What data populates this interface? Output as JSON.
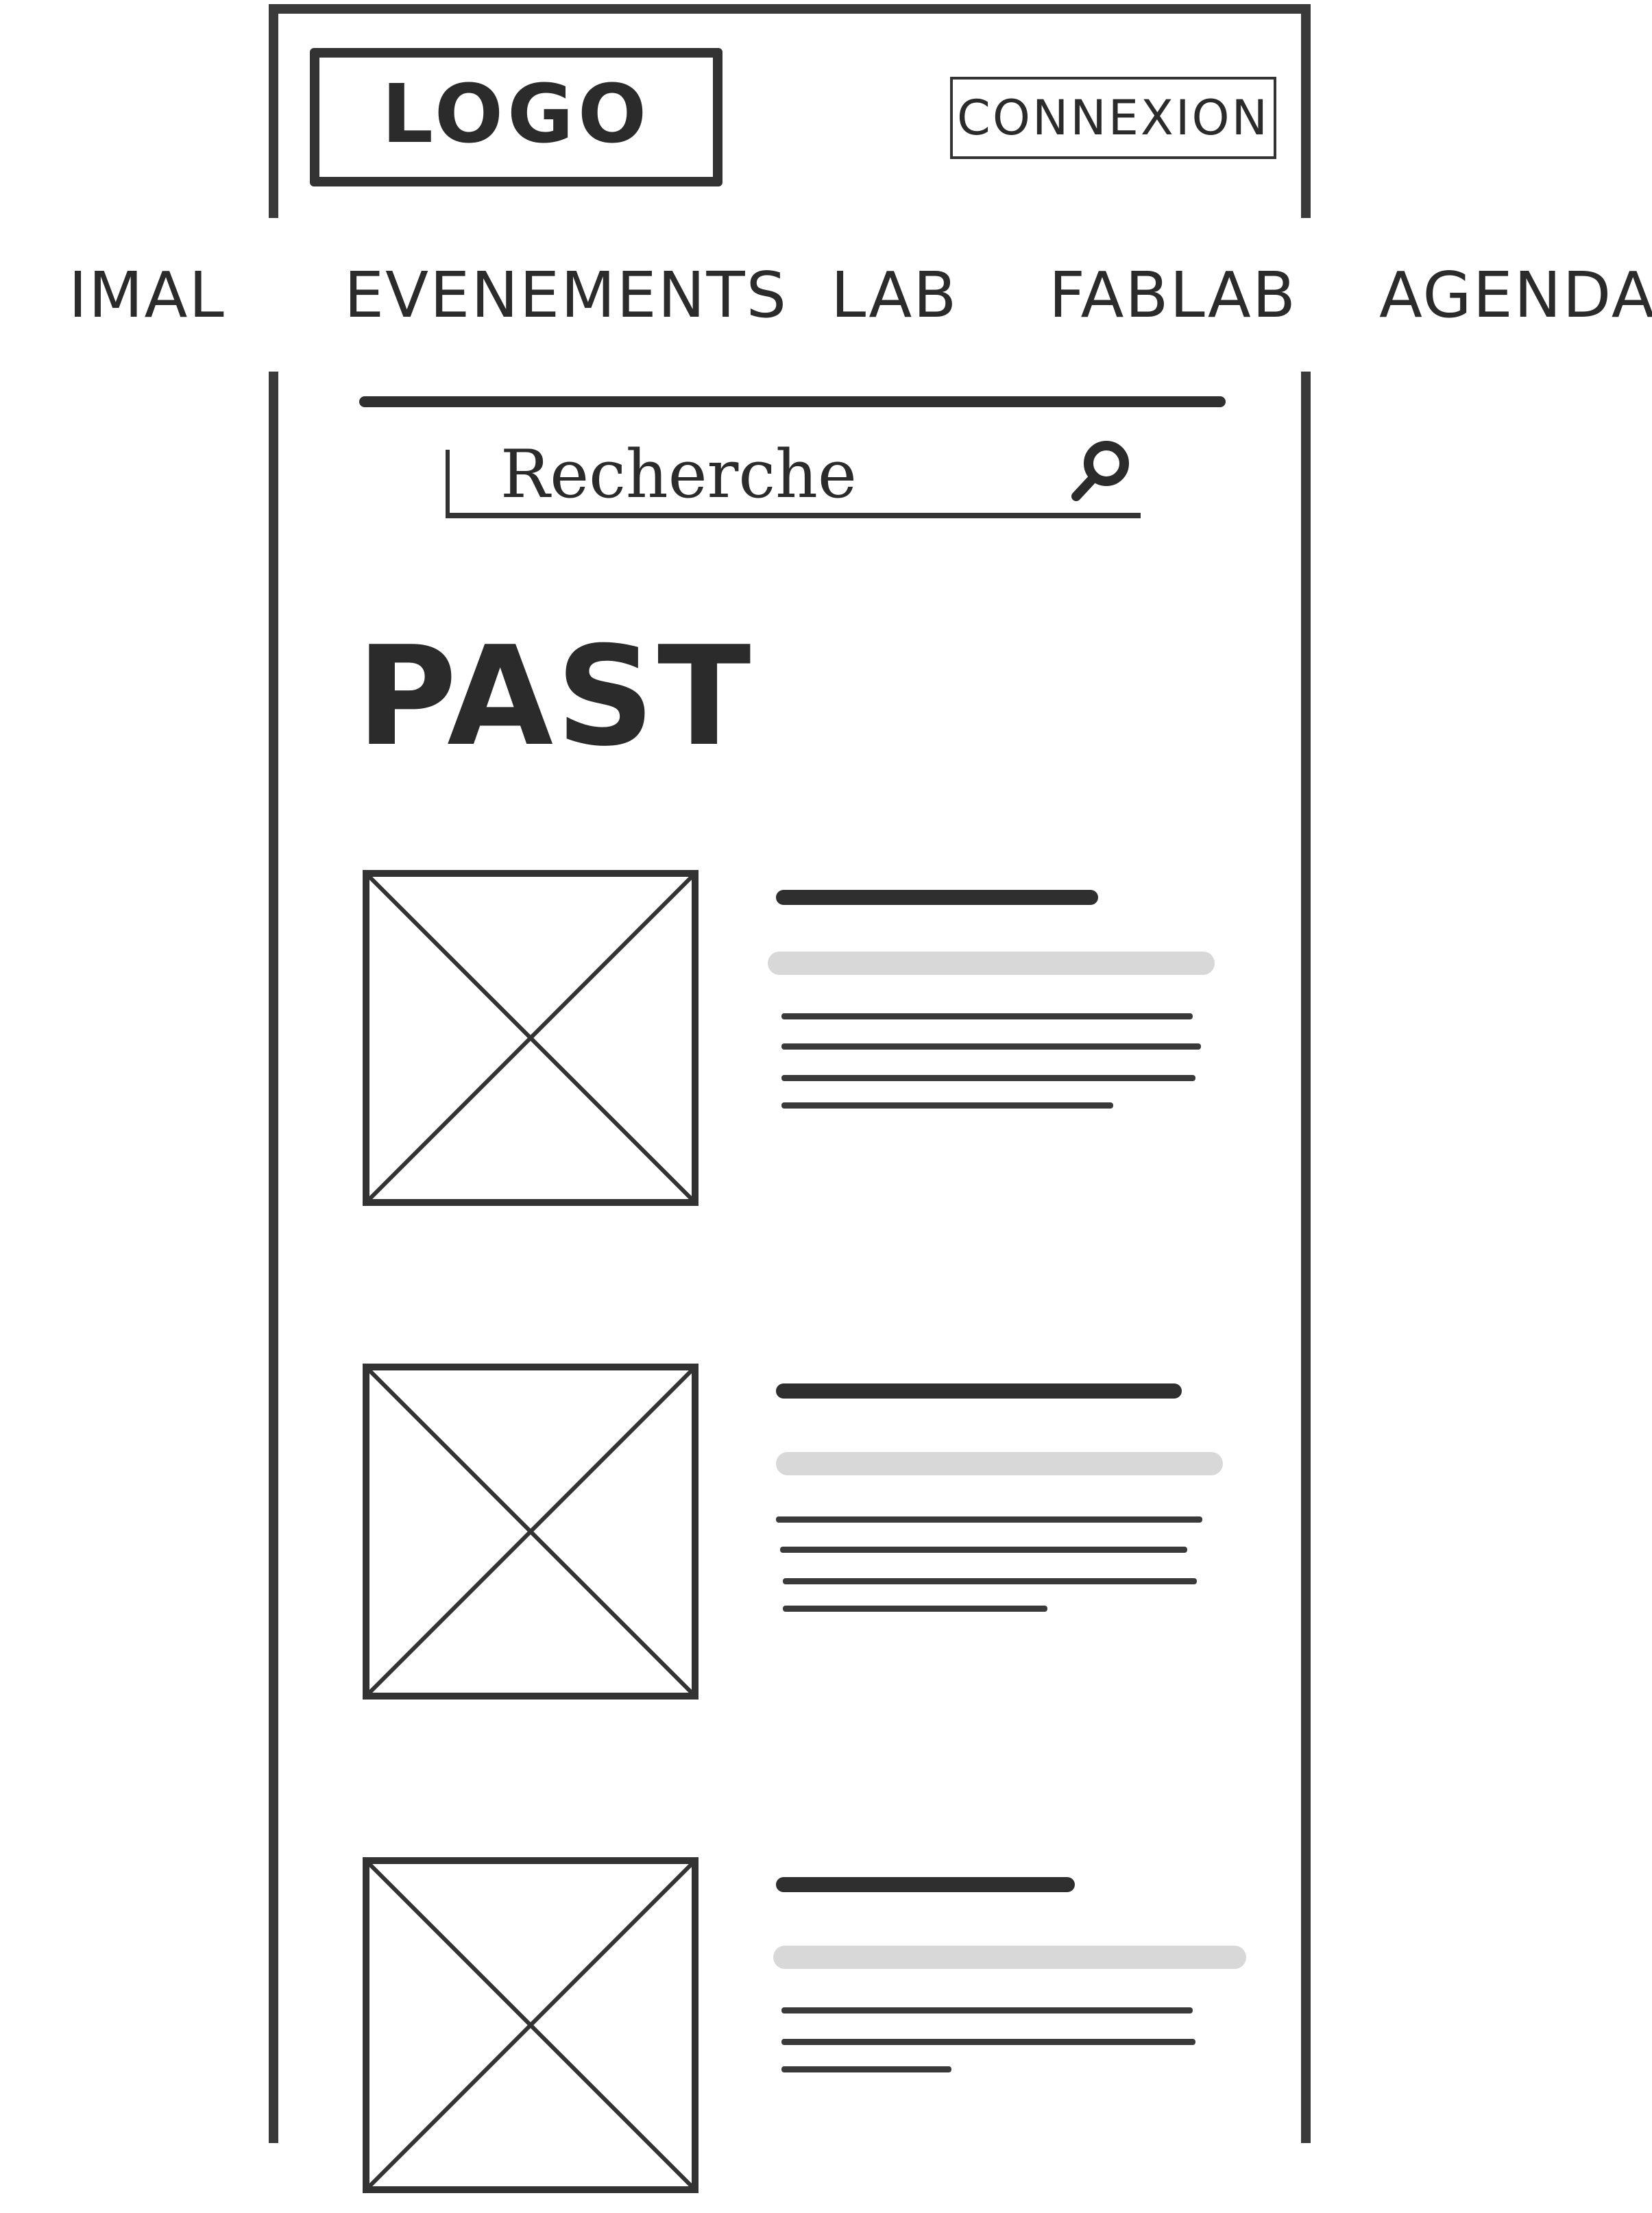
{
  "header": {
    "logo_text": "LOGO",
    "login_label": "CONNEXION"
  },
  "nav": {
    "items": [
      {
        "label": "IMAL"
      },
      {
        "label": "EVENEMENTS"
      },
      {
        "label": "LAB"
      },
      {
        "label": "FABLAB"
      },
      {
        "label": "AGENDA"
      }
    ]
  },
  "search": {
    "placeholder": "Recherche",
    "icon": "search-icon"
  },
  "section": {
    "title": "PAST"
  },
  "cards": [
    {
      "image": "image-placeholder-icon"
    },
    {
      "image": "image-placeholder-icon"
    },
    {
      "image": "image-placeholder-icon"
    }
  ],
  "colors": {
    "ink": "#2f2f2f",
    "muted": "#d8d8d8",
    "background": "#ffffff"
  }
}
